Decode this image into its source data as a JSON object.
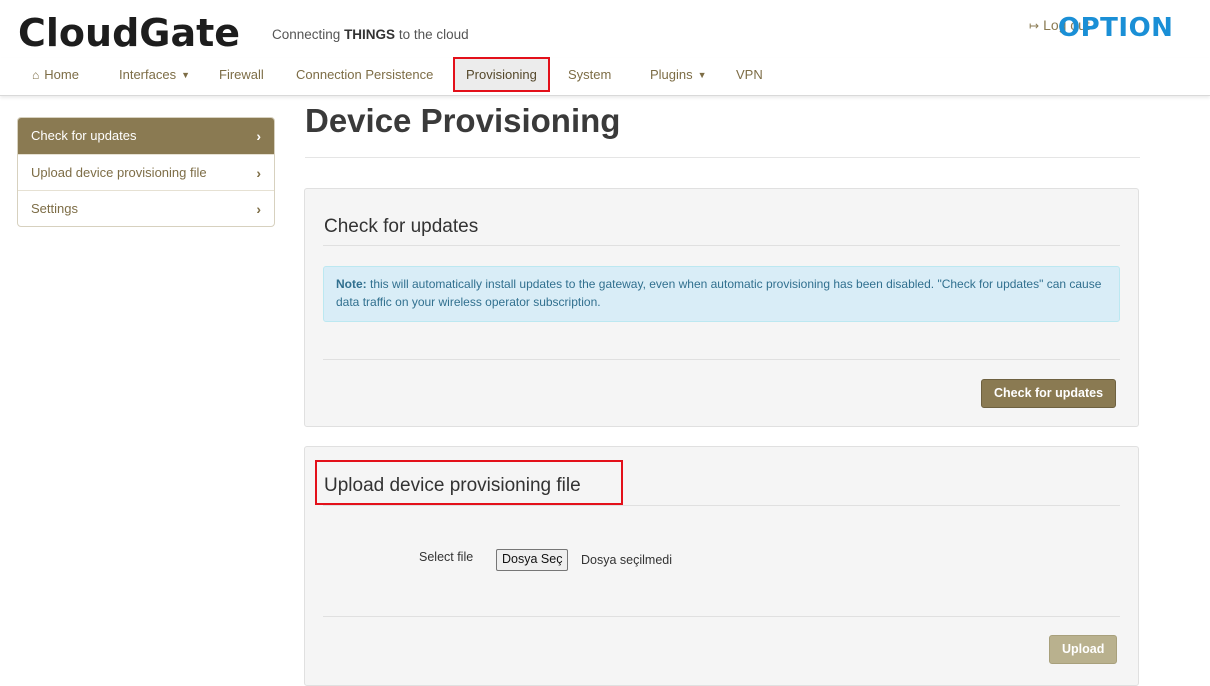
{
  "header": {
    "logo": "CloudGate",
    "tagline_pre": "Connecting ",
    "tagline_bold": "THINGS",
    "tagline_post": " to the cloud",
    "logout_label": "Log out",
    "brand_right": "OPTION"
  },
  "nav": {
    "items": [
      {
        "label": "Home",
        "icon": "home-icon"
      },
      {
        "label": "Interfaces",
        "dropdown": true
      },
      {
        "label": "Firewall"
      },
      {
        "label": "Connection Persistence"
      },
      {
        "label": "Provisioning",
        "active": true
      },
      {
        "label": "System"
      },
      {
        "label": "Plugins",
        "dropdown": true
      },
      {
        "label": "VPN"
      }
    ]
  },
  "sidebar": {
    "items": [
      {
        "label": "Check for updates",
        "active": true
      },
      {
        "label": "Upload device provisioning file"
      },
      {
        "label": "Settings"
      }
    ]
  },
  "main": {
    "title": "Device Provisioning",
    "check_panel": {
      "heading": "Check for updates",
      "note_bold": "Note:",
      "note_text": " this will automatically install updates to the gateway, even when automatic provisioning has been disabled. \"Check for updates\" can cause data traffic on your wireless operator subscription.",
      "button_label": "Check for updates"
    },
    "upload_panel": {
      "heading": "Upload device provisioning file",
      "field_label": "Select file",
      "file_button": "Dosya Seç",
      "file_status": "Dosya seçilmedi",
      "button_label": "Upload"
    }
  },
  "colors": {
    "accent": "#8a7a52",
    "highlight_border": "#e3101a",
    "brand_blue": "#1a8fd6",
    "alert_bg": "#d9edf7"
  }
}
